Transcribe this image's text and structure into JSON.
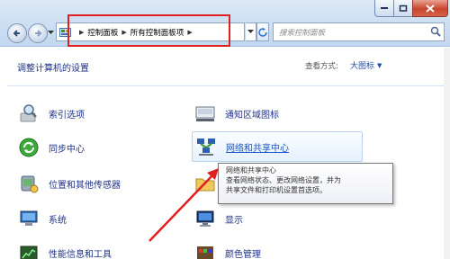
{
  "window": {
    "accent_red": "#e02020",
    "link_color": "#1e3287"
  },
  "address": {
    "crumbs": [
      "控制面板",
      "所有控制面板项"
    ],
    "sep": "▶"
  },
  "search": {
    "placeholder": "搜索控制面板"
  },
  "header": {
    "title": "调整计算机的设置",
    "view_by_label": "查看方式:",
    "view_by_value": "大图标"
  },
  "items": {
    "indexing": "索引选项",
    "notify": "通知区域图标",
    "sync": "同步中心",
    "network": "网络和共享中心",
    "location": "位置和其他传感器",
    "files": "文件",
    "system": "系统",
    "display": "显示",
    "perf": "性能信息和工具",
    "color": "颜色管理"
  },
  "tooltip": {
    "title": "网络和共享中心",
    "line1": "查看网络状态、更改网络设置，并为",
    "line2": "共享文件和打印机设置首选项。"
  }
}
